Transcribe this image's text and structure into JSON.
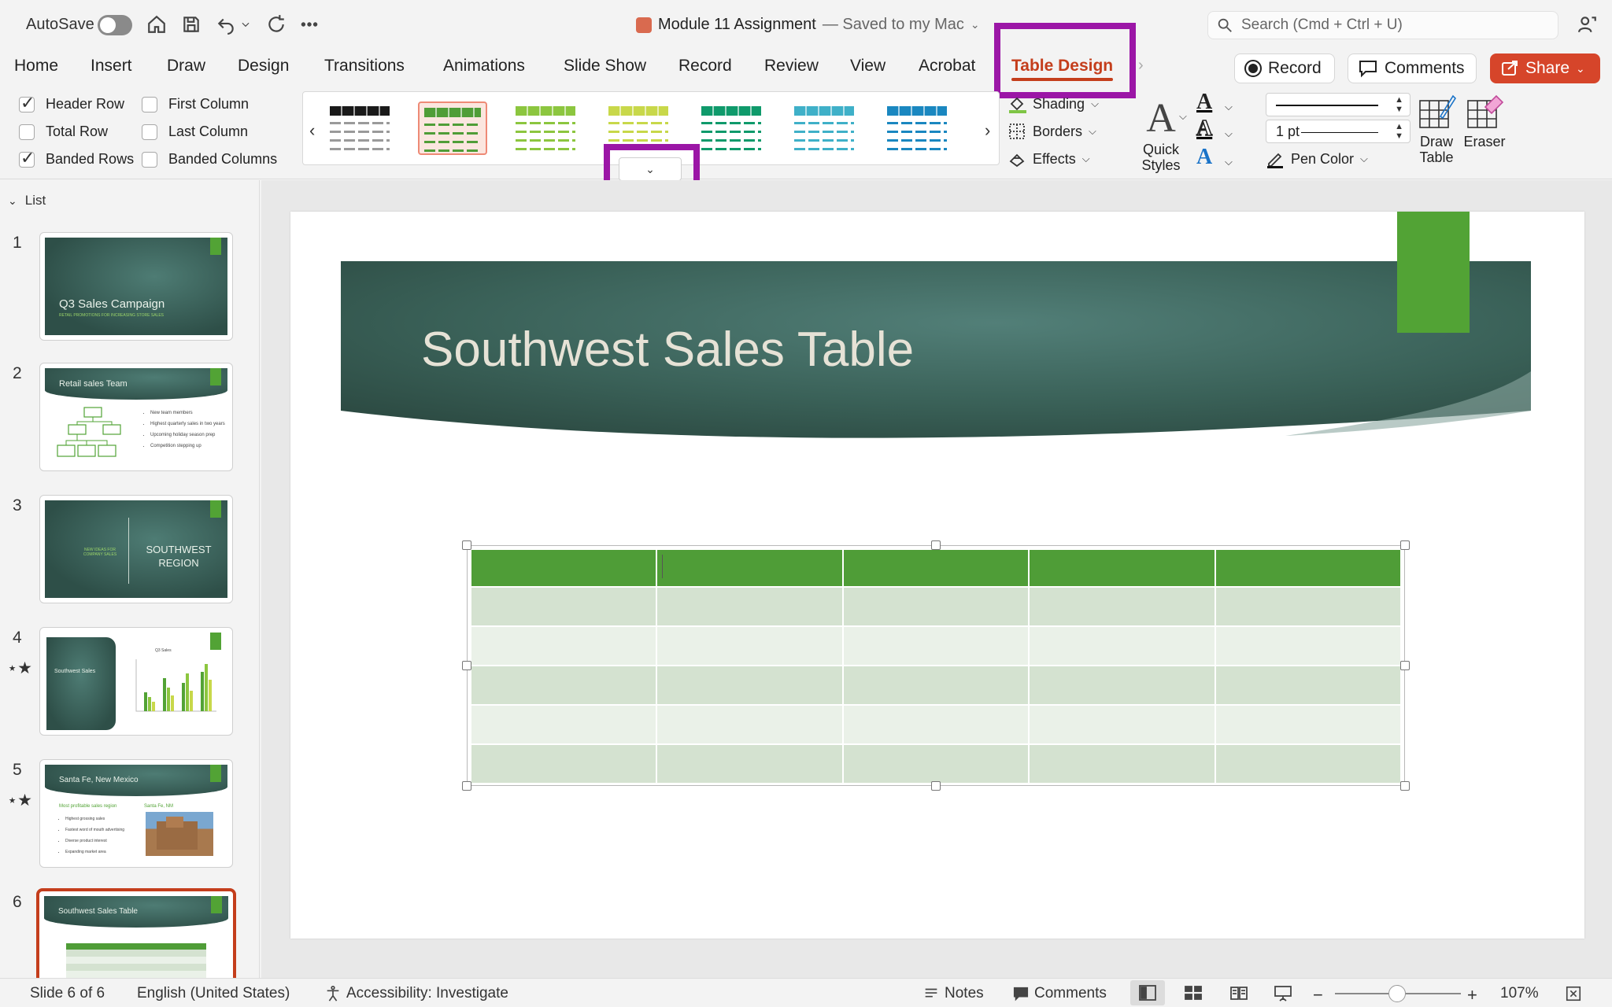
{
  "titlebar": {
    "autosave_label": "AutoSave",
    "doc_name": "Module 11 Assignment",
    "doc_status": "— Saved to my Mac",
    "search_placeholder": "Search (Cmd + Ctrl + U)"
  },
  "tabs": [
    "Home",
    "Insert",
    "Draw",
    "Design",
    "Transitions",
    "Animations",
    "Slide Show",
    "Record",
    "Review",
    "View",
    "Acrobat",
    "Table Design"
  ],
  "active_tab": "Table Design",
  "actions": {
    "record": "Record",
    "comments": "Comments",
    "share": "Share"
  },
  "table_style_options": [
    {
      "label": "Header Row",
      "checked": true
    },
    {
      "label": "Total Row",
      "checked": false
    },
    {
      "label": "Banded Rows",
      "checked": true
    },
    {
      "label": "First Column",
      "checked": false
    },
    {
      "label": "Last Column",
      "checked": false
    },
    {
      "label": "Banded Columns",
      "checked": false
    }
  ],
  "table_styles_gallery": {
    "thumbnail_colors": [
      "#1a1a1a",
      "#4f9d37",
      "#8cc63f",
      "#c8d84a",
      "#0f9a6b",
      "#3fb0c8",
      "#1a87c0"
    ],
    "selected_index": 1
  },
  "shading_group": {
    "shading": "Shading",
    "borders": "Borders",
    "effects": "Effects"
  },
  "wordart": {
    "quick_styles": "Quick Styles"
  },
  "draw_borders": {
    "pen_weight": "1 pt",
    "pen_color": "Pen Color",
    "draw_table": "Draw Table",
    "eraser": "Eraser"
  },
  "slides_panel": {
    "header": "List",
    "slides": [
      {
        "num": "1",
        "title": "Q3 Sales Campaign",
        "subtitle": "RETAIL PROMOTIONS FOR INCREASING STORE SALES",
        "animated": false
      },
      {
        "num": "2",
        "title": "Retail sales Team",
        "animated": false,
        "bullets": [
          "New team members",
          "Highest quarterly sales in two years",
          "Upcoming holiday season prep",
          "Competition stepping up"
        ]
      },
      {
        "num": "3",
        "left_text": "NEW IDEAS FOR COMPANY SALES",
        "right_text": "SOUTHWEST REGION",
        "animated": false
      },
      {
        "num": "4",
        "title": "Southwest Sales",
        "chart_title": "Q3 Sales",
        "animated": true
      },
      {
        "num": "5",
        "title": "Santa Fe, New Mexico",
        "col_head": "Most profitable sales region",
        "img_caption": "Santa Fe, NM",
        "animated": true,
        "bullets": [
          "Highest grossing sales",
          "Fastest word of mouth advertising",
          "Diverse product interest",
          "Expanding market area"
        ]
      },
      {
        "num": "6",
        "title": "Southwest Sales Table",
        "animated": false
      }
    ]
  },
  "slide": {
    "title": "Southwest Sales Table",
    "table": {
      "columns": 5,
      "rows": 6,
      "header_color": "#4f9d37",
      "band_dark": "#d4e2d0",
      "band_light": "#eaf1e8"
    }
  },
  "colors": {
    "accent": "#c43e1c",
    "highlight": "#9b16a6",
    "share": "#d6452a",
    "slide_green": "#52a335"
  },
  "statusbar": {
    "slide_info": "Slide 6 of 6",
    "language": "English (United States)",
    "accessibility": "Accessibility: Investigate",
    "notes": "Notes",
    "comments": "Comments",
    "zoom": "107%"
  }
}
